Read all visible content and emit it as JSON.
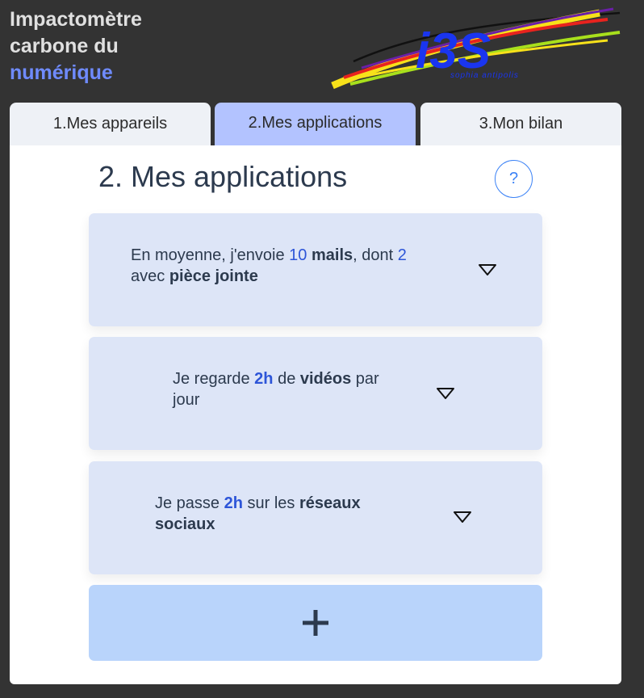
{
  "app": {
    "title_line1": "Impactomètre",
    "title_line2": "carbone du",
    "title_line3": "numérique",
    "logo_text": "i3S",
    "logo_subtext": "sophia antipolis"
  },
  "tabs": [
    {
      "label": "1.Mes appareils",
      "active": false
    },
    {
      "label": "2.Mes applications",
      "active": true
    },
    {
      "label": "3.Mon bilan",
      "active": false
    }
  ],
  "main": {
    "heading": "2. Mes applications",
    "help_label": "?"
  },
  "cards": {
    "mails": {
      "p1": "En moyenne, j'envoie ",
      "count": "10",
      "p2": " ",
      "keyword": "mails",
      "p3": ", dont ",
      "attach_count": "2",
      "p4": "avec ",
      "keyword2": "pièce jointe"
    },
    "videos": {
      "p1": "Je regarde ",
      "hours": "2h",
      "p2": " de ",
      "keyword": "vidéos",
      "p3": " par",
      "p4": "jour"
    },
    "social": {
      "p1": "Je passe ",
      "hours": "2h",
      "p2": " sur les ",
      "keyword": "réseaux",
      "p4": "sociaux"
    }
  },
  "add_button": {
    "label": "+"
  },
  "colors": {
    "background": "#333333",
    "title_accent": "#6f8bff",
    "active_tab": "#b3c3ff",
    "card": "#dde5f7",
    "add_button": "#b9d4fb",
    "number": "#2d55d8",
    "logo_blue": "#1a35f0"
  }
}
